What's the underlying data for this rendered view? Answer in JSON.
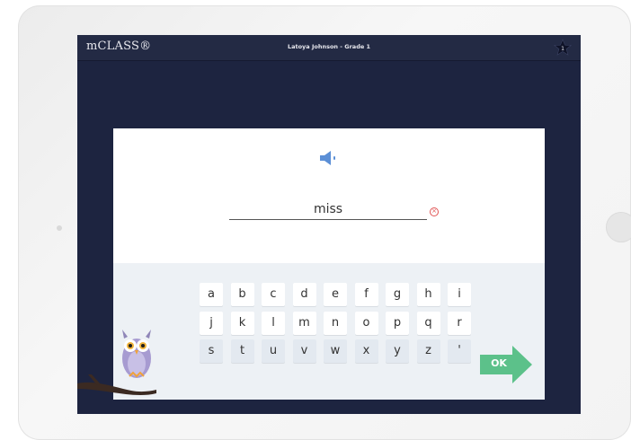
{
  "app": {
    "brand": "mCLASS®",
    "student_label": "Latoya Johnson - Grade 1",
    "star_count": "1"
  },
  "prompt": {
    "speaker_icon": "speaker-icon",
    "answer_text": "miss",
    "clear_icon": "clear-icon"
  },
  "keyboard": {
    "rows": [
      [
        "a",
        "b",
        "c",
        "d",
        "e",
        "f",
        "g",
        "h",
        "i"
      ],
      [
        "j",
        "k",
        "l",
        "m",
        "n",
        "o",
        "p",
        "q",
        "r"
      ],
      [
        "s",
        "t",
        "u",
        "v",
        "w",
        "x",
        "y",
        "z",
        "'"
      ]
    ],
    "ok_label": "OK"
  },
  "colors": {
    "screen_bg": "#1d2440",
    "ok_green": "#5cc18a",
    "speaker_blue": "#5b8fd6",
    "clear_red": "#e05353"
  }
}
